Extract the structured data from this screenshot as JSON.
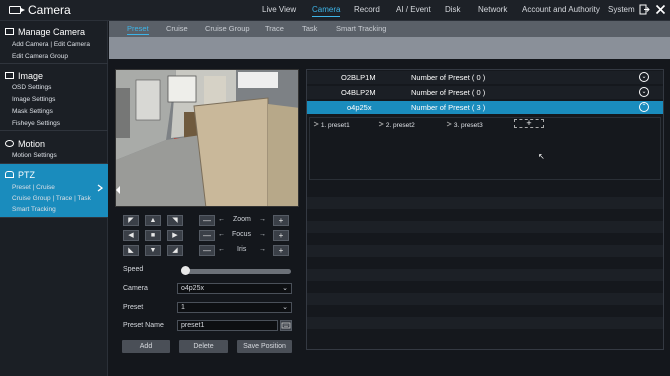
{
  "app": {
    "title": "Camera"
  },
  "topnav": {
    "items": [
      {
        "label": "Live View"
      },
      {
        "label": "Camera"
      },
      {
        "label": "Record"
      },
      {
        "label": "AI / Event"
      },
      {
        "label": "Disk"
      },
      {
        "label": "Network"
      },
      {
        "label": "Account and Authority"
      },
      {
        "label": "System"
      }
    ],
    "active": "Camera",
    "exit_icon": "exit-icon",
    "close_icon": "close-icon"
  },
  "sidebar": {
    "manage": {
      "title": "Manage Camera",
      "sub1": "Add Camera",
      "sub2": "Edit Camera",
      "sub3": "Edit Camera Group"
    },
    "image": {
      "title": "Image",
      "items": [
        "OSD Settings",
        "Image Settings",
        "Mask Settings",
        "Fisheye Settings"
      ]
    },
    "motion": {
      "title": "Motion",
      "items": [
        "Motion Settings"
      ]
    },
    "ptz": {
      "title": "PTZ",
      "sub1": "Preset",
      "sub2": "Cruise",
      "sub3": "Cruise Group",
      "sub4": "Trace",
      "sub5": "Task",
      "sub6": "Smart Tracking",
      "active_color": "#1a8cbd"
    },
    "separator": "|"
  },
  "tabs": {
    "items": [
      "Preset",
      "Cruise",
      "Cruise Group",
      "Trace",
      "Task",
      "Smart Tracking"
    ],
    "active": "Preset"
  },
  "lens": {
    "zoom": "Zoom",
    "focus": "Focus",
    "iris": "Iris",
    "minus": "—",
    "plus": "+",
    "left_arrow": "←",
    "right_arrow": "→"
  },
  "ptz_arrows": {
    "ul": "◤",
    "up": "▲",
    "ur": "◥",
    "left": "◀",
    "center": "■",
    "right": "▶",
    "dl": "◣",
    "down": "▼",
    "dr": "◢"
  },
  "form": {
    "speed_label": "Speed",
    "speed_value": 0,
    "camera_label": "Camera",
    "camera_value": "o4p25x",
    "preset_label": "Preset",
    "preset_value": "1",
    "preset_name_label": "Preset Name",
    "preset_name_value": "preset1",
    "caret": "⌄"
  },
  "buttons": {
    "add": "Add",
    "delete": "Delete",
    "save_position": "Save Position"
  },
  "camera_list": [
    {
      "name": "O2BLP1M",
      "count": "Number of Preset ( 0 )",
      "expanded": false
    },
    {
      "name": "O4BLP2M",
      "count": "Number of Preset ( 0 )",
      "expanded": false
    },
    {
      "name": "o4p25x",
      "count": "Number of Preset ( 3 )",
      "expanded": true
    }
  ],
  "toggle_glyphs": {
    "down": "⌄",
    "up": "⌃"
  },
  "presets": [
    {
      "label": "1. preset1"
    },
    {
      "label": "2. preset2"
    },
    {
      "label": "3. preset3"
    }
  ],
  "preset_add": "+",
  "cursor_glyph": "↖"
}
